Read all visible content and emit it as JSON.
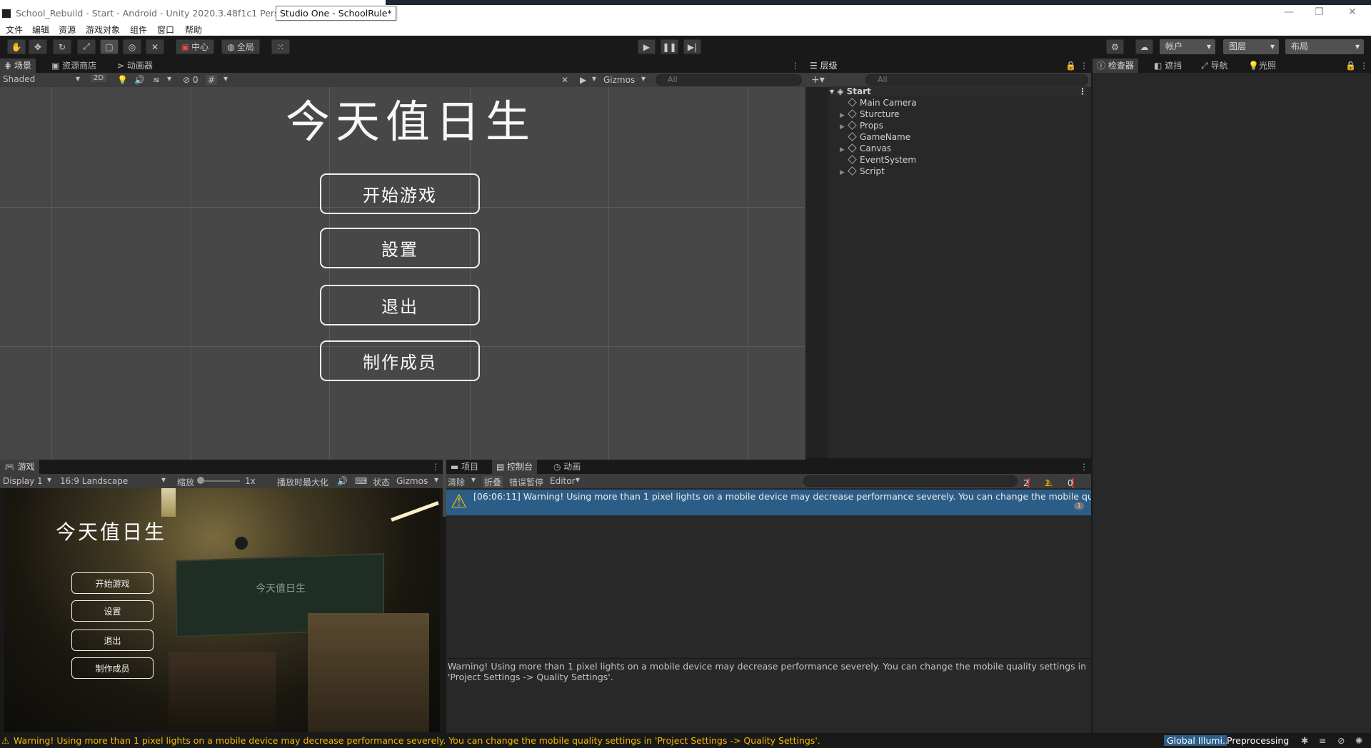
{
  "titlebar": {
    "title": "School_Rebuild - Start - Android - Unity 2020.3.48f1c1 Persona",
    "tooltip": "Studio One - SchoolRule*",
    "minimize": "—",
    "restore": "❐",
    "close": "✕"
  },
  "menu": [
    "文件",
    "编辑",
    "资源",
    "游戏对象",
    "组件",
    "窗口",
    "帮助"
  ],
  "toolbar": {
    "pivot_label": "中心",
    "global_label": "全局",
    "account_label": "帐户",
    "layers_label": "图层",
    "layout_label": "布局"
  },
  "scene_panel": {
    "tabs": [
      "场景",
      "资源商店",
      "动画器"
    ],
    "shading": "Shaded",
    "mode_2d": "2D",
    "fx_count": "0",
    "gizmos": "Gizmos",
    "search_placeholder": "All",
    "title": "今天值日生",
    "buttons": [
      "开始游戏",
      "設置",
      "退出",
      "制作成员"
    ]
  },
  "hierarchy": {
    "tab": "层级",
    "search_placeholder": "All",
    "scene": "Start",
    "items": [
      {
        "name": "Main Camera",
        "expandable": false
      },
      {
        "name": "Sturcture",
        "expandable": true
      },
      {
        "name": "Props",
        "expandable": true
      },
      {
        "name": "GameName",
        "expandable": false
      },
      {
        "name": "Canvas",
        "expandable": true
      },
      {
        "name": "EventSystem",
        "expandable": false
      },
      {
        "name": "Script",
        "expandable": true
      }
    ]
  },
  "inspector": {
    "tabs": [
      "检查器",
      "遮挡",
      "导航",
      "光照"
    ]
  },
  "game_panel": {
    "tab": "游戏",
    "display": "Display 1",
    "aspect": "16:9 Landscape",
    "scale_label": "缩放",
    "scale_value": "1x",
    "maximize": "播放时最大化",
    "stats": "状态",
    "gizmos": "Gizmos",
    "title": "今天值日生",
    "buttons": [
      "开始游戏",
      "设置",
      "退出",
      "制作成员"
    ],
    "blackboard_text": "今天值日生"
  },
  "console": {
    "tabs": [
      "项目",
      "控制台",
      "动画"
    ],
    "clear": "清除",
    "collapse": "折叠",
    "error_pause": "错误暂停",
    "editor": "Editor",
    "counts": {
      "log": "2",
      "warn": "1",
      "error": "0"
    },
    "message": "[06:06:11] Warning! Using more than 1 pixel lights on a mobile device may decrease performance severely. You can change the mobile quality settings in 'Project Settings -> Quality Settings'.",
    "message_count": "1",
    "detail": "Warning! Using more than 1 pixel lights on a mobile device may decrease performance severely. You can change the mobile quality settings in 'Project Settings -> Quality Settings'."
  },
  "statusbar": {
    "message": "Warning! Using more than 1 pixel lights on a mobile device may decrease performance severely. You can change the mobile quality settings in 'Project Settings -> Quality Settings'.",
    "gi_label": "Global Illumi...",
    "gi_status": "Preprocessing"
  },
  "colors": {
    "accent": "#2c5d87",
    "warning": "#f4bc02",
    "panel": "#282828",
    "toolbar": "#3c3c3c"
  }
}
